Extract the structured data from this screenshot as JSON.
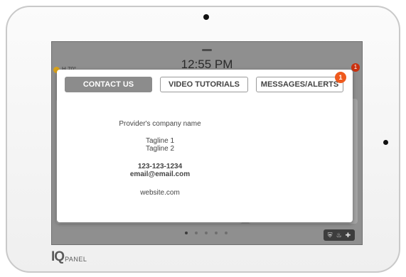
{
  "device": {
    "brand_logo": "IQ",
    "brand_text": "PANEL"
  },
  "home": {
    "time": "12:55 PM",
    "weather": "H 70°",
    "alert_count": "1",
    "pages_total": 5,
    "tray_icons": [
      "shield-icon",
      "flame-icon",
      "plus-icon"
    ]
  },
  "modal": {
    "tabs": [
      {
        "label": "CONTACT US",
        "active": true
      },
      {
        "label": "VIDEO TUTORIALS",
        "active": false
      },
      {
        "label": "MESSAGES/ALERTS",
        "active": false,
        "badge": "1"
      }
    ],
    "contact": {
      "company": "Provider's company name",
      "tagline1": "Tagline 1",
      "tagline2": "Tagline 2",
      "phone": "123-123-1234",
      "email": "email@email.com",
      "website": "website.com"
    }
  },
  "colors": {
    "active_tab": "#8c8c8c",
    "badge": "#ef5a1e",
    "screen_dim": "#8f8f8f"
  }
}
